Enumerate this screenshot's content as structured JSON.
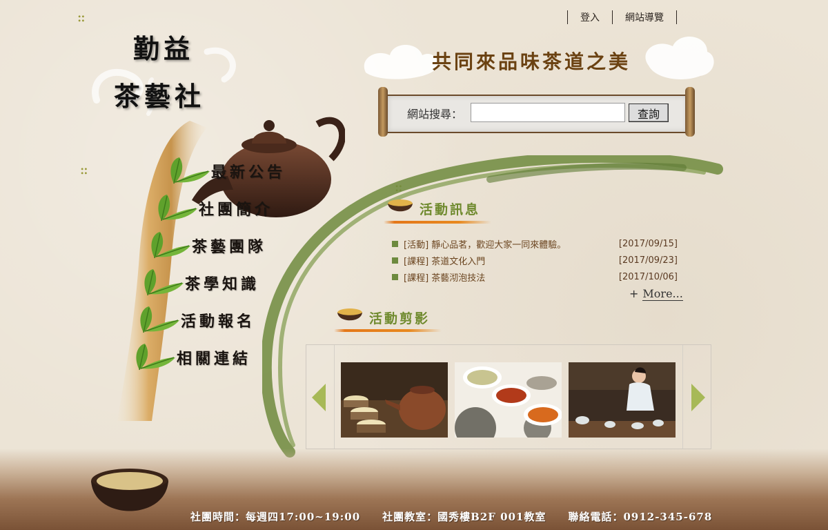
{
  "header": {
    "links": [
      {
        "label": "登入"
      },
      {
        "label": "網站導覽"
      }
    ],
    "logo": {
      "line1": "勤益",
      "line2": "茶藝社"
    },
    "slogan": "共同來品味茶道之美"
  },
  "search": {
    "label": "網站搜尋：",
    "value": "",
    "button_label": "查詢"
  },
  "nav": {
    "items": [
      {
        "label": "最新公告"
      },
      {
        "label": "社團簡介"
      },
      {
        "label": "茶藝團隊"
      },
      {
        "label": "茶學知識"
      },
      {
        "label": "活動報名"
      },
      {
        "label": "相關連結"
      }
    ]
  },
  "news": {
    "title": "活動訊息",
    "items": [
      {
        "text": "[活動] 靜心品茗，歡迎大家一同來體驗。",
        "date": "[2017/09/15]"
      },
      {
        "text": "[課程] 茶道文化入門",
        "date": "[2017/09/23]"
      },
      {
        "text": "[課程] 茶藝沏泡技法",
        "date": "[2017/10/06]"
      }
    ],
    "more_prefix": "+",
    "more_label": "More..."
  },
  "gallery": {
    "title": "活動剪影",
    "photos": [
      {
        "icon": "teapot-cups-photo"
      },
      {
        "icon": "tea-bowls-photo"
      },
      {
        "icon": "tea-ceremony-photo"
      }
    ]
  },
  "footer": {
    "hours": "社團時間：每週四17:00~19:00",
    "room": "社團教室：國秀樓B2F 001教室",
    "phone": "聯絡電話：0912-345-678"
  },
  "colors": {
    "accent_green": "#6d8a3e",
    "brand_brown": "#6b4212",
    "underline_orange": "#e4781a"
  }
}
